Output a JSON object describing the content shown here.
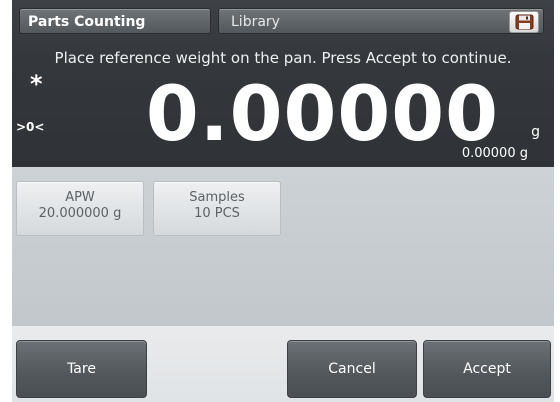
{
  "header": {
    "app_tab": "Parts Counting",
    "library_tab": "Library",
    "save_icon": "save-icon"
  },
  "instruction": "Place reference weight on the pan.  Press Accept to continue.",
  "display": {
    "stable_indicator": "*",
    "zero_indicator": ">0<",
    "reading": "0.00000",
    "unit": "g",
    "secondary_reading": "0.00000 g"
  },
  "params": [
    {
      "label": "APW",
      "value": "20.000000 g"
    },
    {
      "label": "Samples",
      "value": "10 PCS"
    }
  ],
  "buttons": {
    "tare": "Tare",
    "cancel": "Cancel",
    "accept": "Accept"
  }
}
